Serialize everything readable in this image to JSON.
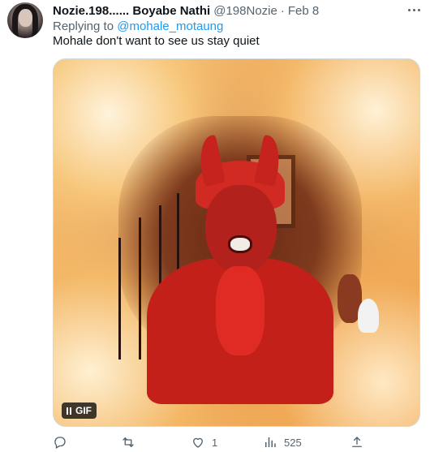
{
  "tweet": {
    "author_name": "Nozie.198...... Boyabe Nathi",
    "author_handle": "@198Nozie",
    "separator": "·",
    "date": "Feb 8",
    "reply_prefix": "Replying to ",
    "reply_to": "@mohale_motaung",
    "text": "Mohale don't want to see us stay quiet"
  },
  "media": {
    "badge_label": "GIF",
    "badge_icon": "pause-icon"
  },
  "actions": {
    "reply_count": "",
    "retweet_count": "",
    "like_count": "1",
    "views_count": "525"
  },
  "colors": {
    "text_primary": "#0f1419",
    "text_secondary": "#536471",
    "accent": "#1d9bf0"
  }
}
